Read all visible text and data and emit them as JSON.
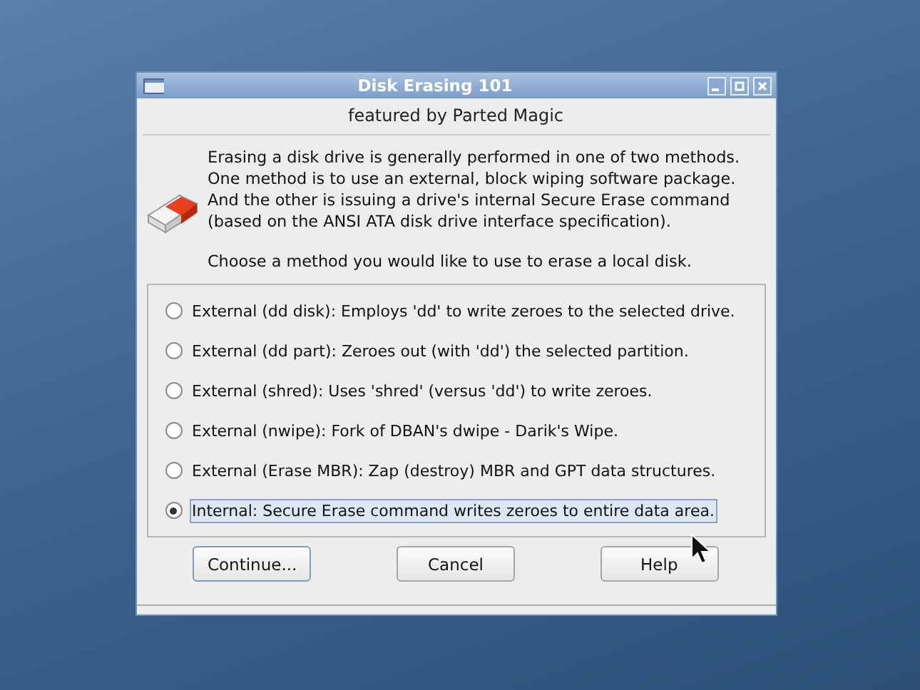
{
  "window": {
    "title": "Disk Erasing 101"
  },
  "subtitle": "featured by Parted Magic",
  "intro": {
    "lines": [
      "Erasing a disk drive is generally performed in one of two methods.",
      "One method is to use an external, block wiping software package.",
      "And the other is issuing a drive's internal Secure Erase command",
      "(based on the ANSI ATA disk drive interface specification)."
    ],
    "prompt": "Choose a method you would like to use to erase a local disk."
  },
  "options": [
    {
      "label": "External (dd disk): Employs 'dd' to write zeroes to the selected drive.",
      "selected": false
    },
    {
      "label": "External (dd part): Zeroes out (with 'dd') the selected partition.",
      "selected": false
    },
    {
      "label": "External (shred): Uses 'shred' (versus 'dd') to write zeroes.",
      "selected": false
    },
    {
      "label": "External (nwipe): Fork of DBAN's dwipe - Darik's Wipe.",
      "selected": false
    },
    {
      "label": "External (Erase MBR): Zap (destroy) MBR and GPT data structures.",
      "selected": false
    },
    {
      "label": "Internal: Secure Erase command writes zeroes to entire data area.",
      "selected": true
    }
  ],
  "buttons": [
    {
      "label": "Continue...",
      "selected": true
    },
    {
      "label": "Cancel",
      "selected": false
    },
    {
      "label": "Help",
      "selected": false
    }
  ]
}
